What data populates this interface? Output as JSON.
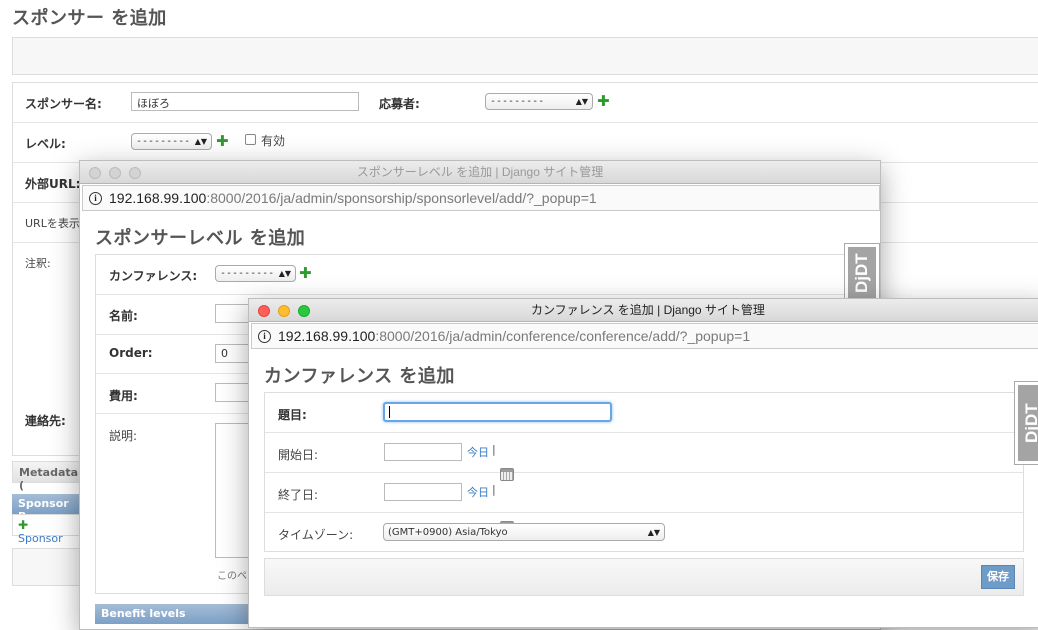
{
  "base": {
    "title": "スポンサー を追加",
    "fields": {
      "name_label": "スポンサー名:",
      "name_value": "ほぼろ",
      "applicant_label": "応募者:",
      "applicant_select": "---------",
      "level_label": "レベル:",
      "level_select": "---------",
      "active_label": "有効",
      "external_url_label": "外部URL:",
      "show_url_label": "URLを表示",
      "note_label": "注釈:",
      "contact_label": "連絡先:"
    },
    "metadata_label": "Metadata (",
    "sponsor_benefits_label": "Sponsor Be",
    "sponsor_add_link": "Sponsor"
  },
  "win1": {
    "window_title": "スポンサーレベル を追加 | Django サイト管理",
    "url_host": "192.168.99.100",
    "url_path": ":8000/2016/ja/admin/sponsorship/sponsorlevel/add/?_popup=1",
    "page_title": "スポンサーレベル を追加",
    "conference_label": "カンファレンス:",
    "conference_select": "---------",
    "name_label": "名前:",
    "order_label": "Order:",
    "order_value": "0",
    "cost_label": "費用:",
    "desc_label": "説明:",
    "help_text": "このペ",
    "benefit_levels_label": "Benefit levels",
    "djdt": "DjDT"
  },
  "win2": {
    "window_title": "カンファレンス を追加 | Django サイト管理",
    "url_host": "192.168.99.100",
    "url_path": ":8000/2016/ja/admin/conference/conference/add/?_popup=1",
    "page_title": "カンファレンス を追加",
    "title_label": "題目:",
    "start_label": "開始日:",
    "end_label": "終了日:",
    "today_link": "今日",
    "sep": "|",
    "tz_label": "タイムゾーン:",
    "tz_value": "(GMT+0900) Asia/Tokyo",
    "save_label": "保存",
    "djdt": "DjDT"
  },
  "colors": {
    "traffic_red": "#ff5f57",
    "traffic_yellow": "#febc2e",
    "traffic_green": "#28c840",
    "focus_blue": "#6aa5e6",
    "save_button": "#6f9bc8"
  }
}
